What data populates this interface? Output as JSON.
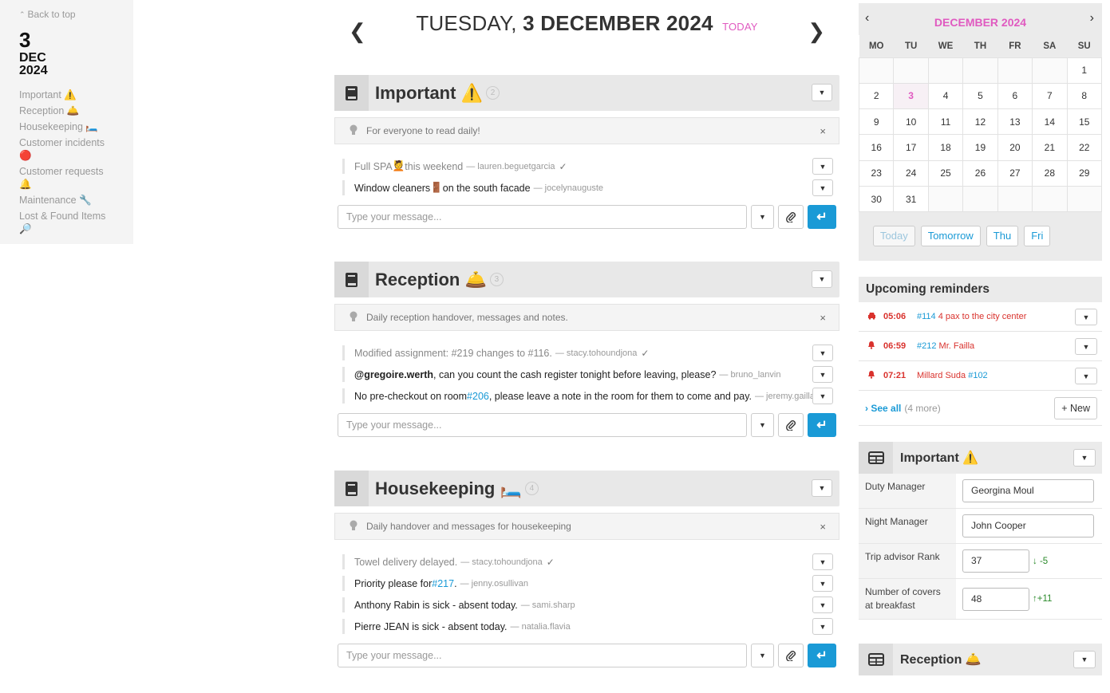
{
  "leftnav": {
    "back_to_top": "Back to top",
    "day": "3",
    "month": "DEC",
    "year": "2024",
    "items": [
      {
        "label": "Important",
        "emoji": "⚠️"
      },
      {
        "label": "Reception",
        "emoji": "🛎️"
      },
      {
        "label": "Housekeeping",
        "emoji": "🛏️"
      },
      {
        "label": "Customer incidents",
        "emoji": "🔴"
      },
      {
        "label": "Customer requests",
        "emoji": "🔔"
      },
      {
        "label": "Maintenance",
        "emoji": "🔧"
      },
      {
        "label": "Lost & Found Items",
        "emoji": "🔎"
      }
    ]
  },
  "dayhead": {
    "weekday": "TUESDAY,",
    "date": "3 DECEMBER 2024",
    "today_label": "TODAY"
  },
  "sections": [
    {
      "title": "Important",
      "emoji": "⚠️",
      "count": "2",
      "tip": "For everyone to read daily!",
      "messages": [
        {
          "pre": "Full SPA ",
          "emoji": "💆",
          "post": " this weekend",
          "author": "— lauren.beguetgarcia",
          "done": true
        },
        {
          "pre": "Window cleaners ",
          "emoji": "🚪",
          "post": " on the south facade",
          "author": "— jocelynauguste",
          "done": false
        }
      ]
    },
    {
      "title": "Reception",
      "emoji": "🛎️",
      "count": "3",
      "tip": "Daily reception handover, messages and notes.",
      "messages": [
        {
          "pre": "Modified assignment: #219 changes to #116.",
          "author": "— stacy.tohoundjona",
          "done": true
        },
        {
          "mention": "@gregoire.werth",
          "pre": ", can you count the cash register tonight before leaving, please?",
          "author": "— bruno_lanvin",
          "done": false
        },
        {
          "pre": "No pre-checkout on room ",
          "link": "#206",
          "post": ", please leave a note in the room for them to come and pay.",
          "author": "— jeremy.gaillard",
          "done": false
        }
      ]
    },
    {
      "title": "Housekeeping",
      "emoji": "🛏️",
      "count": "4",
      "tip": "Daily handover and messages for housekeeping",
      "messages": [
        {
          "pre": "Towel delivery delayed.",
          "author": "— stacy.tohoundjona",
          "done": true
        },
        {
          "pre": "Priority please for ",
          "link": "#217",
          "post": ".",
          "author": "— jenny.osullivan",
          "done": false
        },
        {
          "pre": "Anthony Rabin is sick - absent today.",
          "author": "— sami.sharp",
          "done": false
        },
        {
          "pre": "Pierre JEAN is sick - absent today.",
          "author": "— natalia.flavia",
          "done": false
        }
      ]
    }
  ],
  "composer": {
    "placeholder": "Type your message..."
  },
  "calendar": {
    "title": "DECEMBER 2024",
    "weekdays": [
      "MO",
      "TU",
      "WE",
      "TH",
      "FR",
      "SA",
      "SU"
    ],
    "weeks": [
      [
        "",
        "",
        "",
        "",
        "",
        "",
        "1"
      ],
      [
        "2",
        "3",
        "4",
        "5",
        "6",
        "7",
        "8"
      ],
      [
        "9",
        "10",
        "11",
        "12",
        "13",
        "14",
        "15"
      ],
      [
        "16",
        "17",
        "18",
        "19",
        "20",
        "21",
        "22"
      ],
      [
        "23",
        "24",
        "25",
        "26",
        "27",
        "28",
        "29"
      ],
      [
        "30",
        "31",
        "",
        "",
        "",
        "",
        ""
      ]
    ],
    "today": "3",
    "quick": [
      "Today",
      "Tomorrow",
      "Thu",
      "Fri"
    ]
  },
  "reminders": {
    "title": "Upcoming reminders",
    "items": [
      {
        "icon": "car-icon",
        "time": "05:06",
        "link": "#114",
        "text": " 4 pax to the city center"
      },
      {
        "icon": "bell-icon",
        "time": "06:59",
        "link": "#212",
        "text": " Mr. Failla"
      },
      {
        "icon": "bell-icon",
        "time": "07:21",
        "pre": "Millard Suda ",
        "link": "#102"
      }
    ],
    "see_all": "See all",
    "more": "(4 more)",
    "new_label": "+ New"
  },
  "panel_important": {
    "title": "Important",
    "emoji": "⚠️",
    "rows": [
      {
        "label": "Duty Manager",
        "value": "Georgina Moul"
      },
      {
        "label": "Night Manager",
        "value": "John Cooper"
      },
      {
        "label": "Trip advisor Rank",
        "value": "37",
        "delta": "-5",
        "direction": "down"
      },
      {
        "label": "Number of covers at breakfast",
        "value": "48",
        "delta": "+11",
        "direction": "up"
      }
    ]
  },
  "panel_reception": {
    "title": "Reception",
    "emoji": "🛎️"
  },
  "colors": {
    "accent": "#1a9ad6",
    "today": "#e05ac0",
    "reminder": "#d9322d",
    "positive": "#2a8a2a"
  }
}
